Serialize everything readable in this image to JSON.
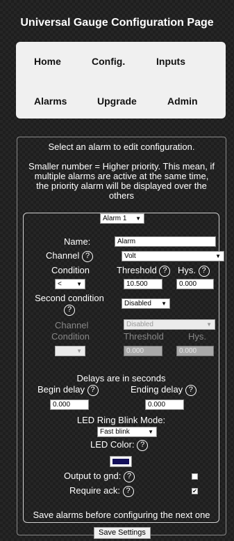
{
  "header": {
    "title": "Universal Gauge Configuration Page"
  },
  "nav": {
    "home": "Home",
    "config": "Config.",
    "inputs": "Inputs",
    "alarms": "Alarms",
    "upgrade": "Upgrade",
    "admin": "Admin"
  },
  "intro": {
    "select_text": "Select an alarm to edit configuration.",
    "priority_line1": "Smaller number = Higher priority. This mean, if",
    "priority_line2": "multiple alarms are active at the same time,",
    "priority_line3": "the priority alarm will be displayed over the",
    "priority_line4": "others"
  },
  "alarm_select": {
    "value": "Alarm 1"
  },
  "form": {
    "name_label": "Name:",
    "name_value": "Alarm",
    "channel_label": "Channel",
    "channel_value": "Volt",
    "condition_label": "Condition",
    "condition_value": "<",
    "threshold_label": "Threshold",
    "threshold_value": "10.500",
    "hys_label": "Hys.",
    "hys_value": "0.000",
    "second_condition_label": "Second condition",
    "second_condition_value": "Disabled",
    "channel2_label": "Channel",
    "channel2_value": "Disabled",
    "condition2_label": "Condition",
    "threshold2_label": "Threshold",
    "threshold2_value": "0.000",
    "hys2_label": "Hys.",
    "hys2_value": "0.000",
    "delays_heading": "Delays are in seconds",
    "begin_delay_label": "Begin delay",
    "begin_delay_value": "0.000",
    "ending_delay_label": "Ending delay",
    "ending_delay_value": "0.000",
    "led_mode_label": "LED Ring Blink Mode:",
    "led_mode_value": "Fast blink",
    "led_color_label": "LED Color:",
    "led_color": "#14105a",
    "output_label": "Output to gnd:",
    "output_checked": false,
    "ack_label": "Require ack:",
    "ack_checked": true
  },
  "footer": {
    "note": "Save alarms before configuring the next one",
    "save_label": "Save Settings"
  },
  "icons": {
    "help": "?",
    "dropdown": "▼",
    "check": "✔"
  }
}
